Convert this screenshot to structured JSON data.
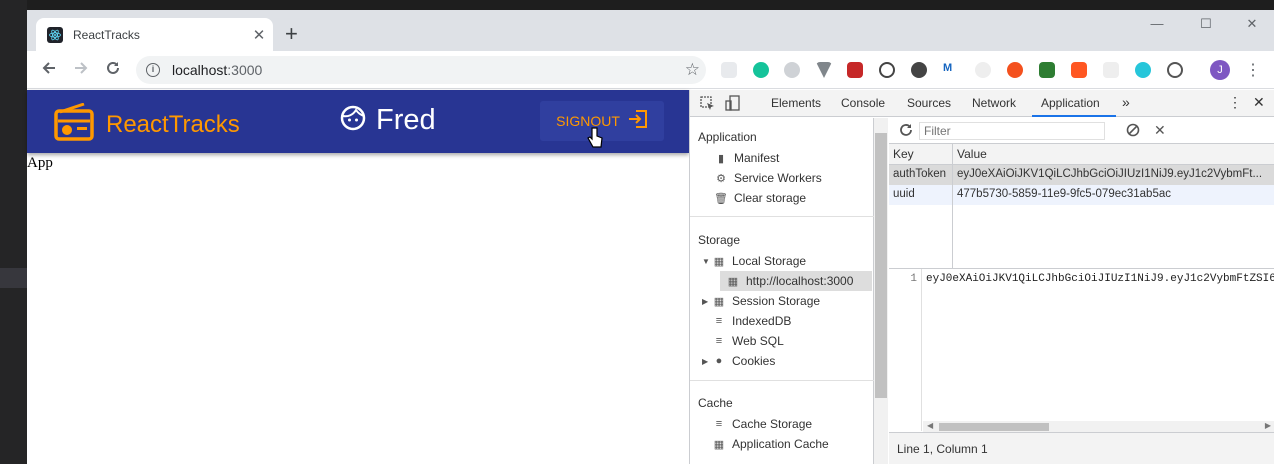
{
  "browser": {
    "tab_title": "ReactTracks",
    "tab_close": "✕",
    "new_tab": "+",
    "url_host": "localhost",
    "url_port": ":3000",
    "win_minimize": "—",
    "win_maximize": "☐",
    "win_close": "✕",
    "avatar_initial": "J"
  },
  "app": {
    "brand": "ReactTracks",
    "username": "Fred",
    "signout_label": "SIGNOUT",
    "body_text": "App",
    "bar_color": "#283593",
    "accent_color": "#ff9800"
  },
  "devtools": {
    "tabs": [
      "Elements",
      "Console",
      "Sources",
      "Network",
      "Application"
    ],
    "more_tabs": "»",
    "active_tab": "Application",
    "sidebar": {
      "application_title": "Application",
      "application_items": [
        "Manifest",
        "Service Workers",
        "Clear storage"
      ],
      "storage_title": "Storage",
      "local_storage": "Local Storage",
      "local_storage_origin": "http://localhost:3000",
      "session_storage": "Session Storage",
      "indexeddb": "IndexedDB",
      "websql": "Web SQL",
      "cookies": "Cookies",
      "cache_title": "Cache",
      "cache_items": [
        "Cache Storage",
        "Application Cache"
      ]
    },
    "filter_placeholder": "Filter",
    "table": {
      "headers": [
        "Key",
        "Value"
      ],
      "rows": [
        {
          "key": "authToken",
          "value": "eyJ0eXAiOiJKV1QiLCJhbGciOiJIUzI1NiJ9.eyJ1c2VybmFt..."
        },
        {
          "key": "uuid",
          "value": "477b5730-5859-11e9-9fc5-079ec31ab5ac"
        }
      ]
    },
    "preview": {
      "line_number": "1",
      "code": "eyJ0eXAiOiJKV1QiLCJhbGciOiJIUzI1NiJ9.eyJ1c2VybmFtZSI6"
    },
    "status": "Line 1, Column 1"
  }
}
